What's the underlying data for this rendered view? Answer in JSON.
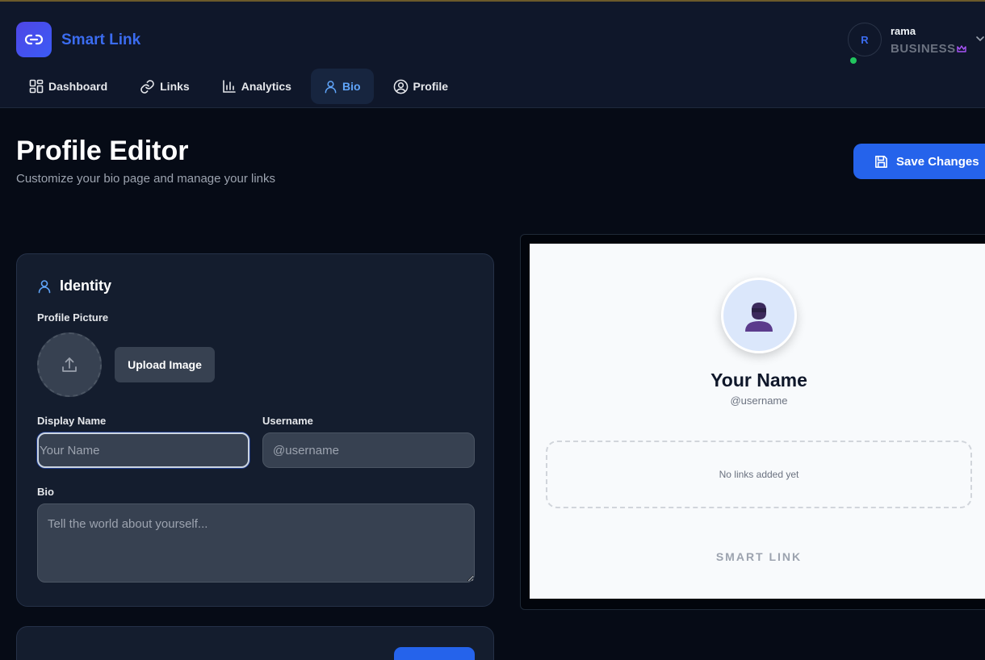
{
  "app": {
    "name": "Smart Link",
    "logo_icon": "link-icon",
    "accent": "#3b6cf0"
  },
  "user": {
    "initial": "R",
    "name": "rama",
    "plan": "BUSINESS",
    "plan_icon": "crown-icon",
    "status": "online"
  },
  "nav": {
    "items": [
      {
        "label": "Dashboard",
        "icon": "dashboard-icon"
      },
      {
        "label": "Links",
        "icon": "link-icon"
      },
      {
        "label": "Analytics",
        "icon": "analytics-icon"
      },
      {
        "label": "Bio",
        "icon": "user-icon",
        "active": true
      },
      {
        "label": "Profile",
        "icon": "profile-circle-icon"
      }
    ]
  },
  "page": {
    "title": "Profile Editor",
    "subtitle": "Customize your bio page and manage your links",
    "save_label": "Save Changes"
  },
  "identity": {
    "heading": "Identity",
    "profile_picture_label": "Profile Picture",
    "upload_label": "Upload Image",
    "display_name_label": "Display Name",
    "display_name_placeholder": "Your Name",
    "display_name_value": "",
    "username_label": "Username",
    "username_prefix": "@",
    "username_placeholder": "username",
    "username_value": "",
    "bio_label": "Bio",
    "bio_placeholder": "Tell the world about yourself...",
    "bio_value": ""
  },
  "preview": {
    "name": "Your Name",
    "username": "@username",
    "empty_links": "No links added yet",
    "brand": "SMART LINK"
  }
}
